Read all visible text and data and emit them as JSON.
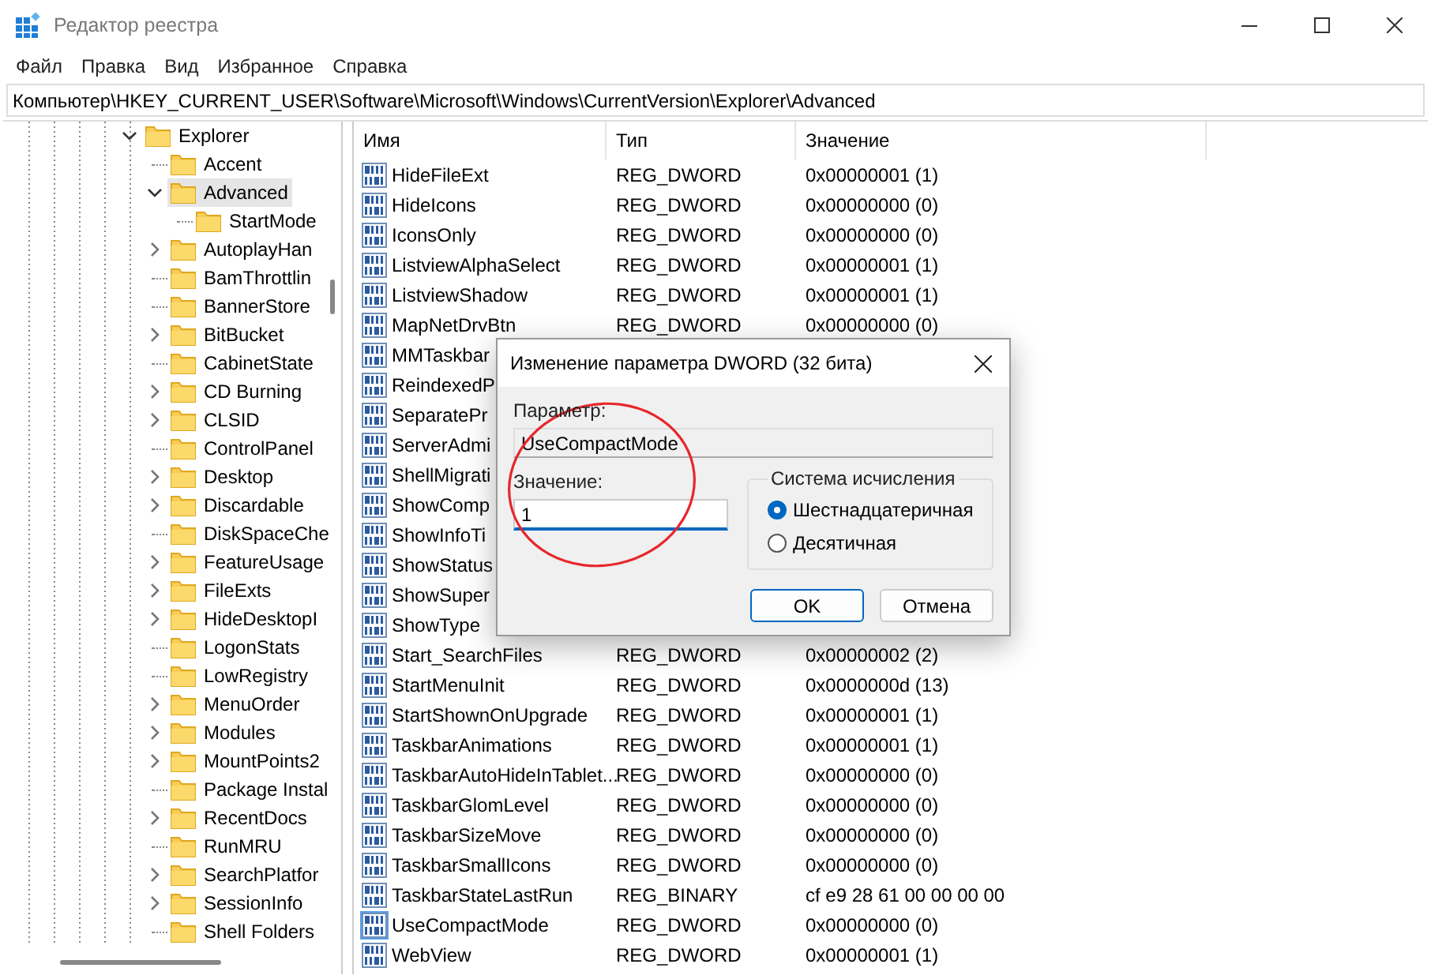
{
  "window": {
    "title": "Редактор реестра"
  },
  "menu": [
    "Файл",
    "Правка",
    "Вид",
    "Избранное",
    "Справка"
  ],
  "address_bar": {
    "value": "Компьютер\\HKEY_CURRENT_USER\\Software\\Microsoft\\Windows\\CurrentVersion\\Explorer\\Advanced"
  },
  "tree": {
    "items": [
      {
        "label": "Explorer",
        "kind": "branch",
        "expanded": true,
        "selected": false,
        "children": [
          {
            "label": "Accent",
            "kind": "leaf",
            "selected": false
          },
          {
            "label": "Advanced",
            "kind": "branch",
            "expanded": true,
            "selected": true,
            "children": [
              {
                "label": "StartMode",
                "kind": "leaf",
                "selected": false
              }
            ]
          },
          {
            "label": "AutoplayHan",
            "kind": "branch",
            "expanded": false,
            "selected": false
          },
          {
            "label": "BamThrottlin",
            "kind": "leaf",
            "selected": false
          },
          {
            "label": "BannerStore",
            "kind": "leaf",
            "selected": false
          },
          {
            "label": "BitBucket",
            "kind": "branch",
            "expanded": false,
            "selected": false
          },
          {
            "label": "CabinetState",
            "kind": "leaf",
            "selected": false
          },
          {
            "label": "CD Burning",
            "kind": "branch",
            "expanded": false,
            "selected": false
          },
          {
            "label": "CLSID",
            "kind": "branch",
            "expanded": false,
            "selected": false
          },
          {
            "label": "ControlPanel",
            "kind": "leaf",
            "selected": false
          },
          {
            "label": "Desktop",
            "kind": "branch",
            "expanded": false,
            "selected": false
          },
          {
            "label": "Discardable",
            "kind": "branch",
            "expanded": false,
            "selected": false
          },
          {
            "label": "DiskSpaceChe",
            "kind": "leaf",
            "selected": false
          },
          {
            "label": "FeatureUsage",
            "kind": "branch",
            "expanded": false,
            "selected": false
          },
          {
            "label": "FileExts",
            "kind": "branch",
            "expanded": false,
            "selected": false
          },
          {
            "label": "HideDesktopI",
            "kind": "branch",
            "expanded": false,
            "selected": false
          },
          {
            "label": "LogonStats",
            "kind": "leaf",
            "selected": false
          },
          {
            "label": "LowRegistry",
            "kind": "leaf",
            "selected": false
          },
          {
            "label": "MenuOrder",
            "kind": "branch",
            "expanded": false,
            "selected": false
          },
          {
            "label": "Modules",
            "kind": "branch",
            "expanded": false,
            "selected": false
          },
          {
            "label": "MountPoints2",
            "kind": "branch",
            "expanded": false,
            "selected": false
          },
          {
            "label": "Package Instal",
            "kind": "leaf",
            "selected": false
          },
          {
            "label": "RecentDocs",
            "kind": "branch",
            "expanded": false,
            "selected": false
          },
          {
            "label": "RunMRU",
            "kind": "leaf",
            "selected": false
          },
          {
            "label": "SearchPlatfor",
            "kind": "branch",
            "expanded": false,
            "selected": false
          },
          {
            "label": "SessionInfo",
            "kind": "branch",
            "expanded": false,
            "selected": false
          },
          {
            "label": "Shell Folders",
            "kind": "leaf",
            "selected": false
          }
        ]
      }
    ]
  },
  "list": {
    "columns": [
      "Имя",
      "Тип",
      "Значение"
    ],
    "rows": [
      {
        "name": "HideFileExt",
        "type": "REG_DWORD",
        "data": "0x00000001 (1)",
        "selected": false
      },
      {
        "name": "HideIcons",
        "type": "REG_DWORD",
        "data": "0x00000000 (0)",
        "selected": false
      },
      {
        "name": "IconsOnly",
        "type": "REG_DWORD",
        "data": "0x00000000 (0)",
        "selected": false
      },
      {
        "name": "ListviewAlphaSelect",
        "type": "REG_DWORD",
        "data": "0x00000001 (1)",
        "selected": false
      },
      {
        "name": "ListviewShadow",
        "type": "REG_DWORD",
        "data": "0x00000001 (1)",
        "selected": false
      },
      {
        "name": "MapNetDrvBtn",
        "type": "REG_DWORD",
        "data": "0x00000000 (0)",
        "selected": false
      },
      {
        "name": "MMTaskbar",
        "selected": false
      },
      {
        "name": "ReindexedP",
        "selected": false
      },
      {
        "name": "SeparatePr",
        "selected": false
      },
      {
        "name": "ServerAdmi",
        "selected": false
      },
      {
        "name": "ShellMigrati",
        "selected": false
      },
      {
        "name": "ShowComp",
        "selected": false
      },
      {
        "name": "ShowInfoTi",
        "selected": false
      },
      {
        "name": "ShowStatus",
        "selected": false
      },
      {
        "name": "ShowSuper",
        "selected": false
      },
      {
        "name": "ShowType",
        "selected": false
      },
      {
        "name": "Start_SearchFiles",
        "type": "REG_DWORD",
        "data": "0x00000002 (2)",
        "selected": false
      },
      {
        "name": "StartMenuInit",
        "type": "REG_DWORD",
        "data": "0x0000000d (13)",
        "selected": false
      },
      {
        "name": "StartShownOnUpgrade",
        "type": "REG_DWORD",
        "data": "0x00000001 (1)",
        "selected": false
      },
      {
        "name": "TaskbarAnimations",
        "type": "REG_DWORD",
        "data": "0x00000001 (1)",
        "selected": false
      },
      {
        "name": "TaskbarAutoHideInTablet...",
        "type": "REG_DWORD",
        "data": "0x00000000 (0)",
        "selected": false
      },
      {
        "name": "TaskbarGlomLevel",
        "type": "REG_DWORD",
        "data": "0x00000000 (0)",
        "selected": false
      },
      {
        "name": "TaskbarSizeMove",
        "type": "REG_DWORD",
        "data": "0x00000000 (0)",
        "selected": false
      },
      {
        "name": "TaskbarSmallIcons",
        "type": "REG_DWORD",
        "data": "0x00000000 (0)",
        "selected": false
      },
      {
        "name": "TaskbarStateLastRun",
        "type": "REG_BINARY",
        "data": "cf e9 28 61 00 00 00 00",
        "selected": false
      },
      {
        "name": "UseCompactMode",
        "type": "REG_DWORD",
        "data": "0x00000000 (0)",
        "selected": true
      },
      {
        "name": "WebView",
        "type": "REG_DWORD",
        "data": "0x00000001 (1)",
        "selected": false
      }
    ]
  },
  "dialog": {
    "title": "Изменение параметра DWORD (32 бита)",
    "parameter_label": "Параметр:",
    "parameter_value": "UseCompactMode",
    "value_label": "Значение:",
    "value": "1",
    "base": {
      "title": "Система исчисления",
      "options": [
        {
          "label": "Шестнадцатеричная",
          "selected": true
        },
        {
          "label": "Десятичная",
          "selected": false
        }
      ]
    },
    "buttons": [
      {
        "label": "OK",
        "default": true
      },
      {
        "label": "Отмена",
        "default": false
      }
    ]
  }
}
